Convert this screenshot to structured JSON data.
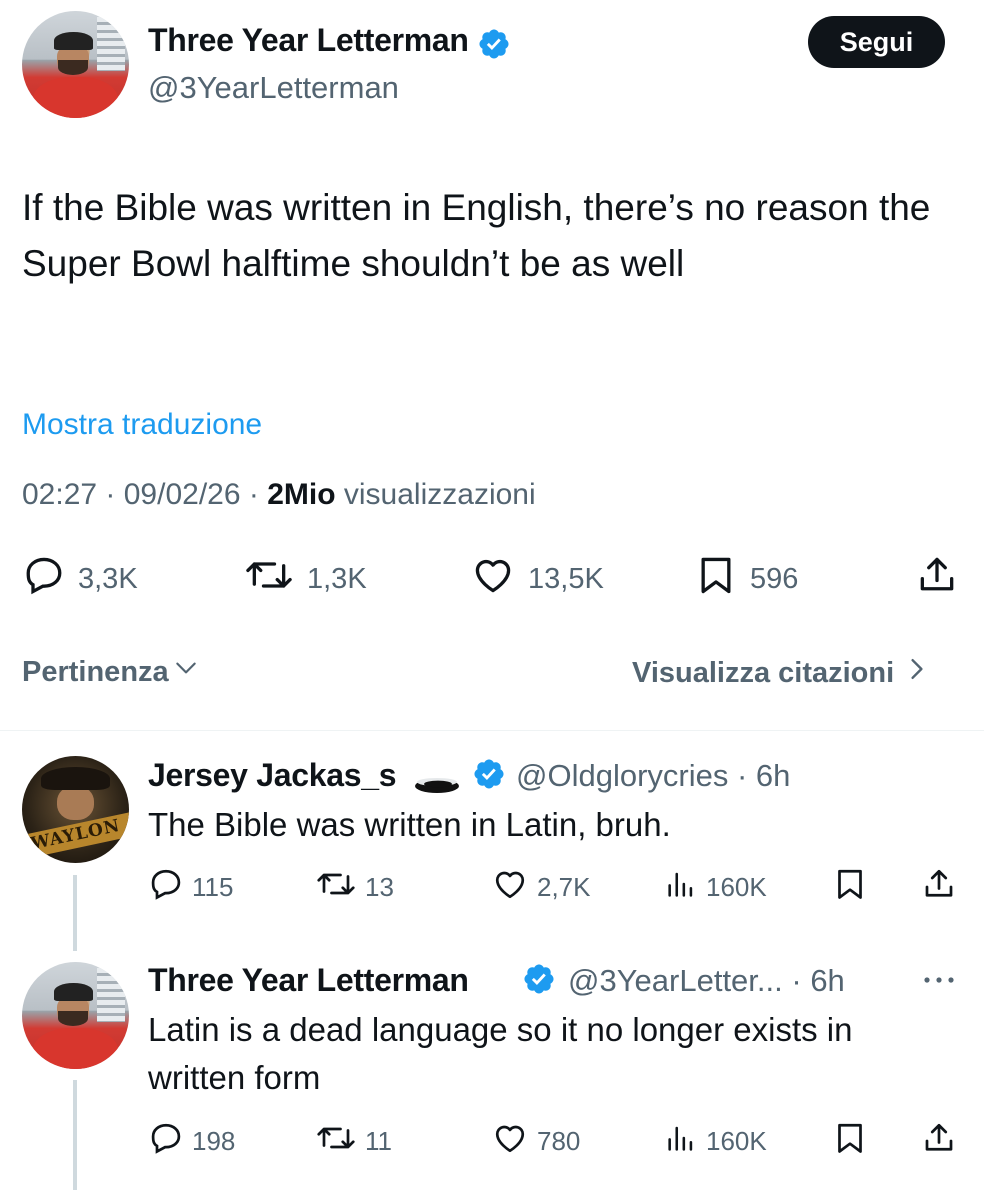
{
  "tweet": {
    "author_name": "Three Year Letterman",
    "author_handle": "@3YearLetterman",
    "follow_label": "Segui",
    "text": "If the Bible was written in English, there’s no reason the Super Bowl halftime shouldn’t be as well",
    "translate_label": "Mostra traduzione",
    "time": "02:27",
    "date": "09/02/26",
    "views_count": "2Mio",
    "views_label": "visualizzazioni",
    "stats": {
      "replies": "3,3K",
      "retweets": "1,3K",
      "likes": "13,5K",
      "bookmarks": "596"
    }
  },
  "filters": {
    "sort_label": "Pertinenza",
    "quotes_label": "Visualizza citazioni"
  },
  "replies": [
    {
      "name": "Jersey Jackas_s",
      "handle": "@Oldglorycries",
      "age": "6h",
      "avatar_text": "WAYLON",
      "text": "The Bible was written in Latin, bruh.",
      "replies": "115",
      "retweets": "13",
      "likes": "2,7K",
      "views": "160K"
    },
    {
      "name": "Three Year Letterman",
      "handle": "@3YearLetter...",
      "age": "6h",
      "text": "Latin is a dead language so it no longer exists in written form",
      "replies": "198",
      "retweets": "11",
      "likes": "780",
      "views": "160K"
    }
  ],
  "colors": {
    "accent": "#1d9bf0",
    "text": "#0f1419",
    "secondary": "#536471",
    "verified": "#1d9bf0"
  },
  "icons": [
    "reply-icon",
    "retweet-icon",
    "like-icon",
    "bookmark-icon",
    "share-icon",
    "views-icon",
    "verified-icon",
    "more-icon",
    "chevron-down-icon",
    "chevron-right-icon"
  ]
}
